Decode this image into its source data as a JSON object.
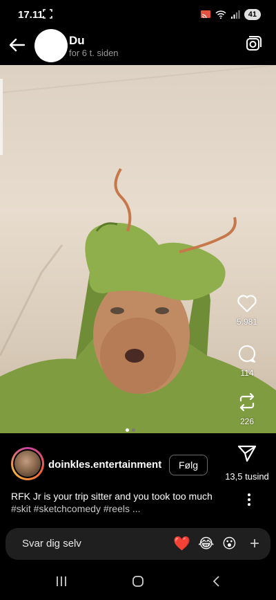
{
  "status_bar": {
    "time": "17.11",
    "battery": "41"
  },
  "header": {
    "name": "Du",
    "time_ago": "for 6 t. siden"
  },
  "actions": {
    "likes": "5.981",
    "comments": "114",
    "reposts": "226",
    "shares": "13,5 tusind"
  },
  "post": {
    "username": "doinkles.entertainment",
    "follow_label": "Følg",
    "caption_text": "RFK Jr is your trip sitter and you took too much ",
    "caption_tags": "#skit #sketchcomedy #reels ..."
  },
  "reply": {
    "placeholder": "Svar dig selv",
    "emojis": [
      "❤️",
      "😂",
      "😮"
    ]
  },
  "colors": {
    "background": "#000000",
    "reply_bar": "#1f1f1f",
    "muted_text": "#9a9a9a"
  }
}
